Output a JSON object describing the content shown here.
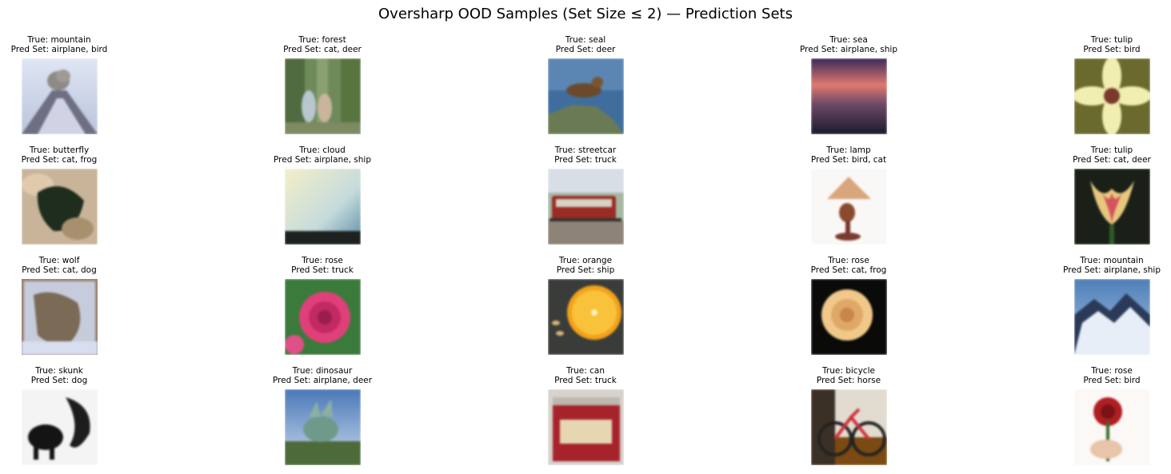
{
  "title": "Oversharp OOD Samples (Set Size ≤ 2) — Prediction Sets",
  "samples": [
    {
      "true_label": "True: mountain",
      "pred_set": "Pred Set: airplane, bird",
      "scene": "mountain"
    },
    {
      "true_label": "True: forest",
      "pred_set": "Pred Set: cat, deer",
      "scene": "forest"
    },
    {
      "true_label": "True: seal",
      "pred_set": "Pred Set: deer",
      "scene": "seal"
    },
    {
      "true_label": "True: sea",
      "pred_set": "Pred Set: airplane, ship",
      "scene": "sea"
    },
    {
      "true_label": "True: tulip",
      "pred_set": "Pred Set: bird",
      "scene": "lily"
    },
    {
      "true_label": "True: butterfly",
      "pred_set": "Pred Set: cat, frog",
      "scene": "butterfly"
    },
    {
      "true_label": "True: cloud",
      "pred_set": "Pred Set: airplane, ship",
      "scene": "cloud"
    },
    {
      "true_label": "True: streetcar",
      "pred_set": "Pred Set: truck",
      "scene": "streetcar"
    },
    {
      "true_label": "True: lamp",
      "pred_set": "Pred Set: bird, cat",
      "scene": "lamp"
    },
    {
      "true_label": "True: tulip",
      "pred_set": "Pred Set: cat, deer",
      "scene": "tulip"
    },
    {
      "true_label": "True: wolf",
      "pred_set": "Pred Set: cat, dog",
      "scene": "wolf"
    },
    {
      "true_label": "True: rose",
      "pred_set": "Pred Set: truck",
      "scene": "pinkrose"
    },
    {
      "true_label": "True: orange",
      "pred_set": "Pred Set: ship",
      "scene": "orange"
    },
    {
      "true_label": "True: rose",
      "pred_set": "Pred Set: cat, frog",
      "scene": "yellowrose"
    },
    {
      "true_label": "True: mountain",
      "pred_set": "Pred Set: airplane, ship",
      "scene": "snowmountain"
    },
    {
      "true_label": "True: skunk",
      "pred_set": "Pred Set: dog",
      "scene": "skunk"
    },
    {
      "true_label": "True: dinosaur",
      "pred_set": "Pred Set: airplane, deer",
      "scene": "dinosaur"
    },
    {
      "true_label": "True: can",
      "pred_set": "Pred Set: truck",
      "scene": "can"
    },
    {
      "true_label": "True: bicycle",
      "pred_set": "Pred Set: horse",
      "scene": "bicycle"
    },
    {
      "true_label": "True: rose",
      "pred_set": "Pred Set: bird",
      "scene": "redrose"
    }
  ]
}
